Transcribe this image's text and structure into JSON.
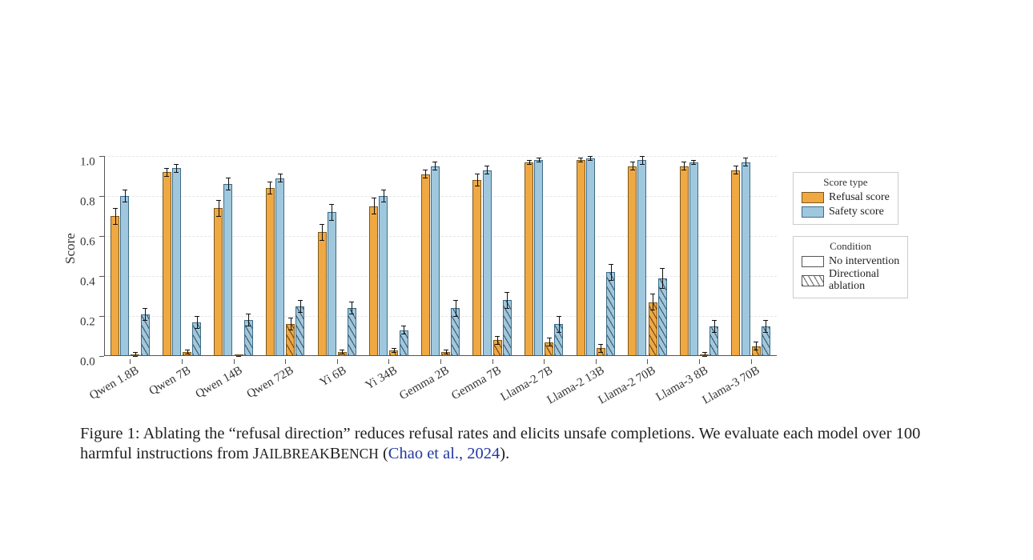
{
  "chart_data": {
    "type": "bar",
    "ylabel": "Score",
    "ylim": [
      0.0,
      1.0
    ],
    "yticks": [
      0.0,
      0.2,
      0.4,
      0.6,
      0.8,
      1.0
    ],
    "categories": [
      "Qwen 1.8B",
      "Qwen 7B",
      "Qwen 14B",
      "Qwen 72B",
      "Yi 6B",
      "Yi 34B",
      "Gemma 2B",
      "Gemma 7B",
      "Llama-2 7B",
      "Llama-2 13B",
      "Llama-2 70B",
      "Llama-3 8B",
      "Llama-3 70B"
    ],
    "series": [
      {
        "name": "Refusal score — No intervention",
        "score_type": "Refusal score",
        "condition": "No intervention",
        "values": [
          0.7,
          0.92,
          0.74,
          0.84,
          0.62,
          0.75,
          0.91,
          0.88,
          0.97,
          0.98,
          0.95,
          0.95,
          0.93
        ],
        "err": [
          0.04,
          0.02,
          0.04,
          0.03,
          0.04,
          0.04,
          0.02,
          0.03,
          0.01,
          0.01,
          0.02,
          0.02,
          0.02
        ]
      },
      {
        "name": "Safety score — No intervention",
        "score_type": "Safety score",
        "condition": "No intervention",
        "values": [
          0.8,
          0.94,
          0.86,
          0.89,
          0.72,
          0.8,
          0.95,
          0.93,
          0.98,
          0.99,
          0.98,
          0.97,
          0.97
        ],
        "err": [
          0.03,
          0.02,
          0.03,
          0.02,
          0.04,
          0.03,
          0.02,
          0.02,
          0.01,
          0.01,
          0.02,
          0.01,
          0.02
        ]
      },
      {
        "name": "Refusal score — Directional ablation",
        "score_type": "Refusal score",
        "condition": "Directional ablation",
        "values": [
          0.01,
          0.02,
          0.0,
          0.16,
          0.02,
          0.03,
          0.02,
          0.08,
          0.07,
          0.04,
          0.27,
          0.01,
          0.05
        ],
        "err": [
          0.01,
          0.01,
          0.0,
          0.03,
          0.01,
          0.01,
          0.01,
          0.02,
          0.02,
          0.02,
          0.04,
          0.01,
          0.02
        ]
      },
      {
        "name": "Safety score — Directional ablation",
        "score_type": "Safety score",
        "condition": "Directional ablation",
        "values": [
          0.21,
          0.17,
          0.18,
          0.25,
          0.24,
          0.13,
          0.24,
          0.28,
          0.16,
          0.42,
          0.39,
          0.15,
          0.15
        ],
        "err": [
          0.03,
          0.03,
          0.03,
          0.03,
          0.03,
          0.02,
          0.04,
          0.04,
          0.04,
          0.04,
          0.05,
          0.03,
          0.03
        ]
      }
    ],
    "legends": {
      "score_type": {
        "title": "Score type",
        "entries": [
          "Refusal score",
          "Safety score"
        ]
      },
      "condition": {
        "title": "Condition",
        "entries": [
          "No intervention",
          "Directional ablation"
        ]
      }
    }
  },
  "caption": {
    "label": "Figure 1:",
    "body_a": "Ablating the “refusal direction” reduces refusal rates and elicits unsafe completions. We evaluate each model over 100 harmful instructions from ",
    "bench": "JailbreakBench",
    "open": " (",
    "ref": "Chao et al., 2024",
    "close": ")."
  }
}
